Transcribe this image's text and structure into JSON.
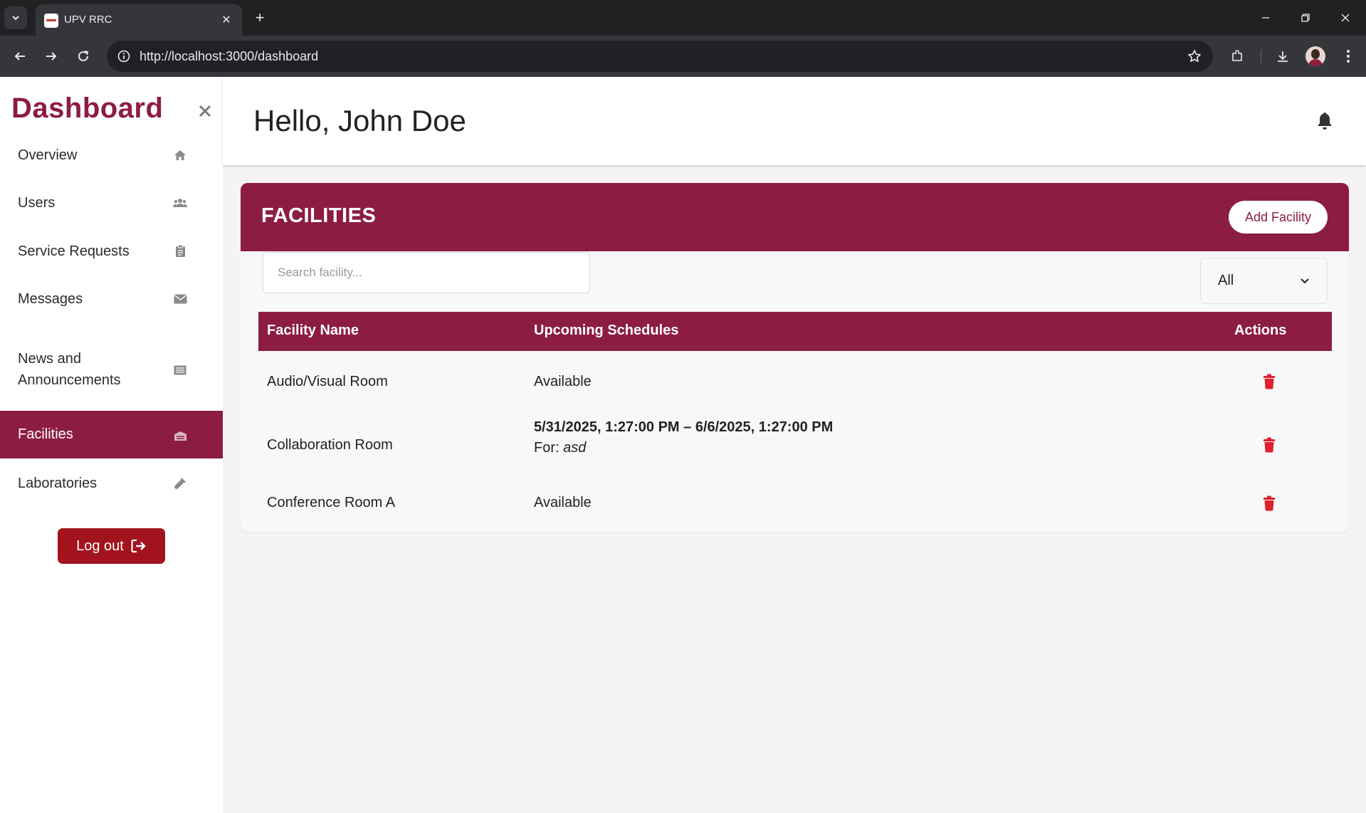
{
  "browser": {
    "tab_title": "UPV RRC",
    "url": "http://localhost:3000/dashboard"
  },
  "sidebar": {
    "brand": "Dashboard",
    "close_icon": "close-icon",
    "items": [
      {
        "label": "Overview",
        "icon": "home-icon"
      },
      {
        "label": "Users",
        "icon": "users-icon"
      },
      {
        "label": "Service Requests",
        "icon": "clipboard-icon"
      },
      {
        "label": "Messages",
        "icon": "envelope-icon"
      },
      {
        "label": "News and Announcements",
        "icon": "newspaper-icon"
      },
      {
        "label": "Facilities",
        "icon": "building-icon",
        "active": true
      },
      {
        "label": "Laboratories",
        "icon": "flask-icon"
      }
    ],
    "logout_label": "Log out"
  },
  "header": {
    "greeting": "Hello, John Doe",
    "bell_icon": "bell-icon"
  },
  "facilities": {
    "title": "FACILITIES",
    "add_label": "Add Facility",
    "search_placeholder": "Search facility...",
    "filter_value": "All",
    "columns": [
      "Facility Name",
      "Upcoming Schedules",
      "Actions"
    ],
    "rows": [
      {
        "name": "Audio/Visual Room",
        "schedule": "Available",
        "schedule_for": ""
      },
      {
        "name": "Collaboration Room",
        "schedule": "5/31/2025, 1:27:00 PM – 6/6/2025, 1:27:00 PM",
        "schedule_for_prefix": "For:",
        "schedule_for": "asd"
      },
      {
        "name": "Conference Room A",
        "schedule": "Available",
        "schedule_for": ""
      }
    ]
  },
  "colors": {
    "accent": "#8c1d40",
    "logout": "#a3131d",
    "delete": "#e0202c"
  }
}
